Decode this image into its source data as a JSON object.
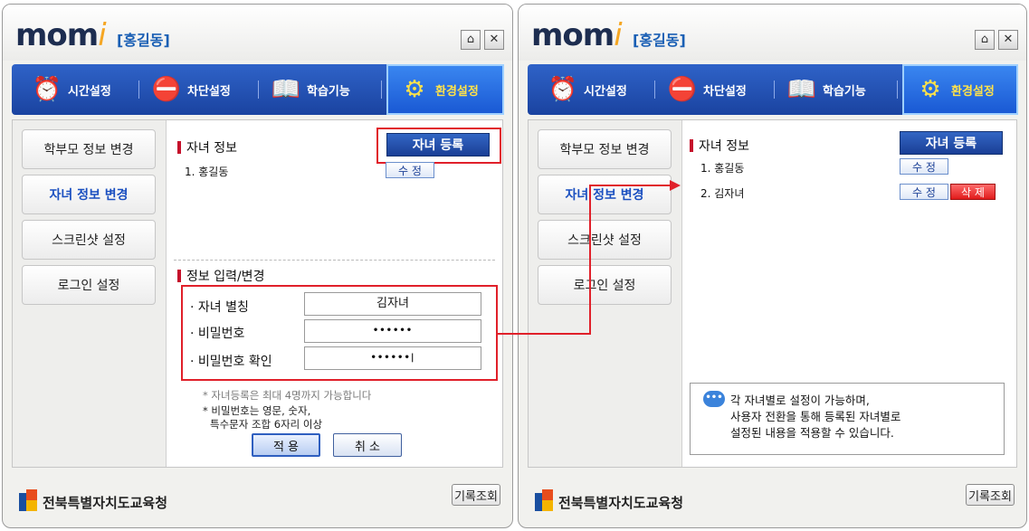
{
  "app": {
    "logo_main": "mom",
    "logo_i": "i",
    "user": "[홍길동]",
    "home_icon": "home-icon",
    "close_icon": "close-icon"
  },
  "tabs": [
    {
      "label": "시간설정",
      "icon": "clock-icon"
    },
    {
      "label": "차단설정",
      "icon": "block-icon"
    },
    {
      "label": "학습기능",
      "icon": "book-icon"
    },
    {
      "label": "환경설정",
      "icon": "gear-icon"
    }
  ],
  "sidebar": [
    {
      "label": "학부모 정보 변경"
    },
    {
      "label": "자녀 정보 변경"
    },
    {
      "label": "스크린샷 설정"
    },
    {
      "label": "로그인 설정"
    }
  ],
  "left_panel": {
    "children_title": "자녀 정보",
    "register_button": "자녀 등록",
    "children": [
      {
        "label": "1. 홍길동",
        "edit": "수 정"
      }
    ],
    "form_title": "정보 입력/변경",
    "fields": [
      {
        "label": "· 자녀 별칭",
        "value": "김자녀"
      },
      {
        "label": "· 비밀번호",
        "value": "••••••"
      },
      {
        "label": "· 비밀번호 확인",
        "value": "••••••|"
      }
    ],
    "notes": [
      "* 자녀등록은 최대 4명까지 가능합니다",
      "* 비밀번호는 영문, 숫자,",
      "특수문자 조합 6자리 이상"
    ],
    "apply_button": "적 용",
    "cancel_button": "취 소"
  },
  "right_panel": {
    "children_title": "자녀 정보",
    "register_button": "자녀 등록",
    "children": [
      {
        "label": "1. 홍길동",
        "edit": "수 정"
      },
      {
        "label": "2. 김자녀",
        "edit": "수 정",
        "delete": "삭 제"
      }
    ],
    "info_lines": [
      "각 자녀별로 설정이 가능하며,",
      "사용자 전환을 통해 등록된 자녀별로",
      "설정된 내용을 적용할 수 있습니다."
    ],
    "bubble_text": "•••"
  },
  "footer": {
    "org_name": "전북특별자치도교육청",
    "history_button": "기록조회"
  },
  "colors": {
    "highlight": "#e0202a",
    "tab_bg": "#1a43a0",
    "active_tab_text": "#ffe24a"
  }
}
